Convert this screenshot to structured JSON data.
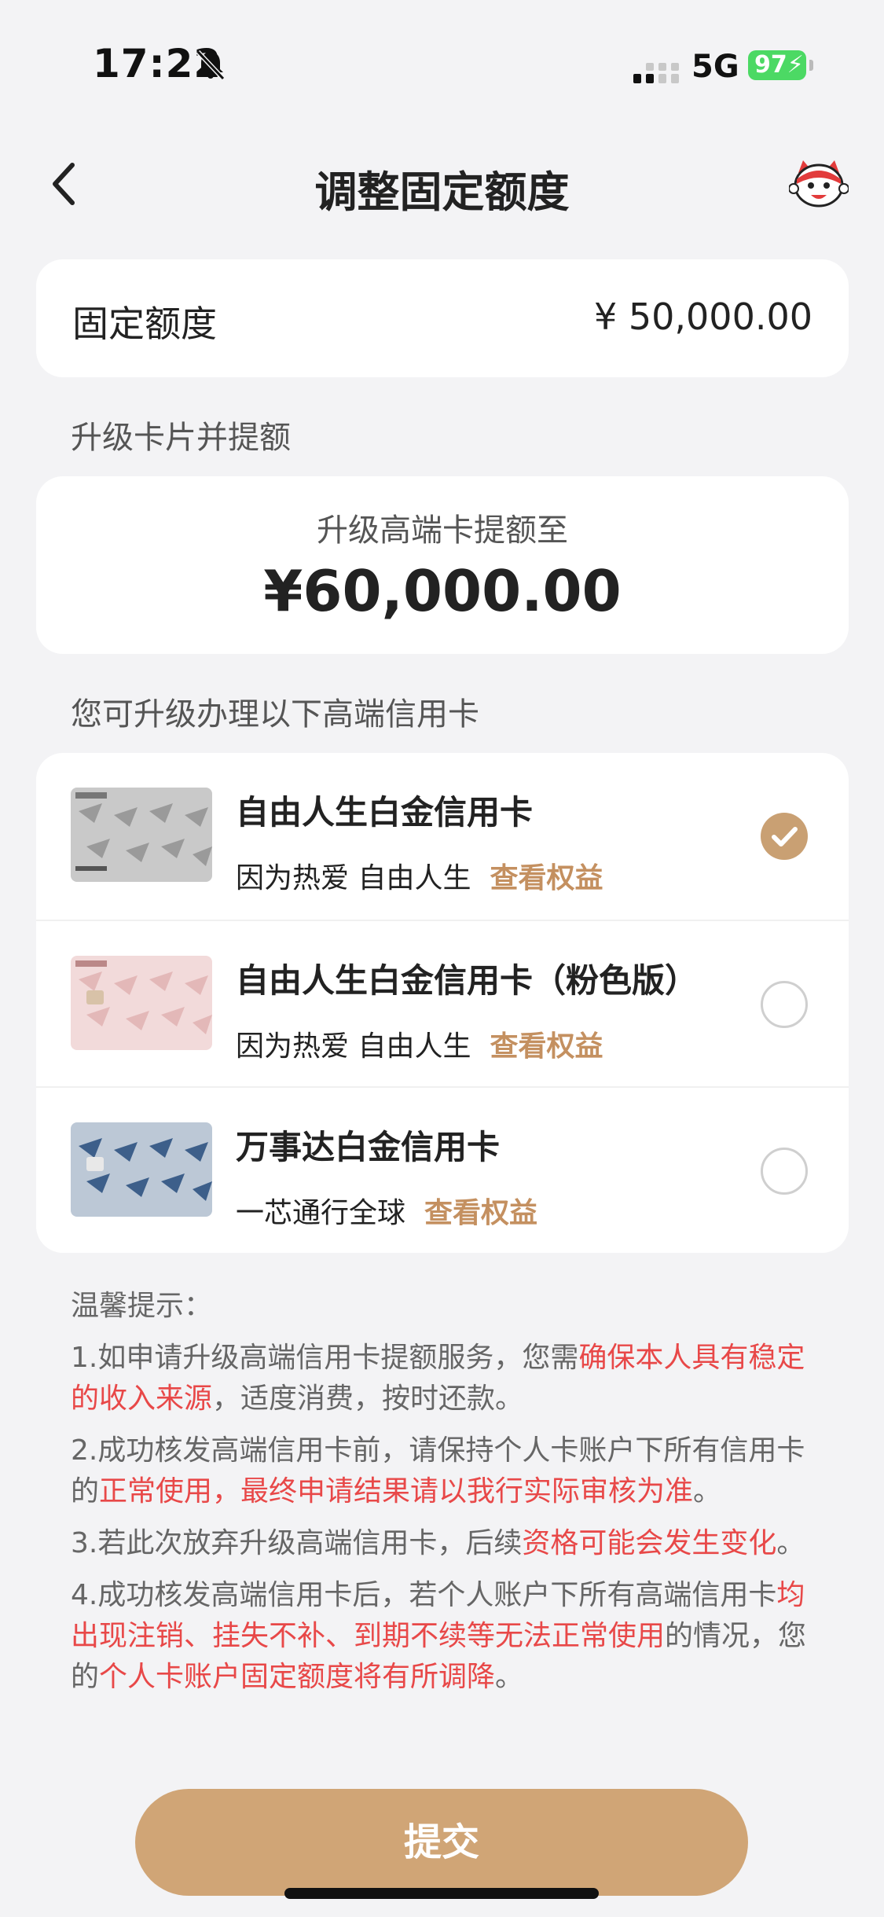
{
  "status_bar": {
    "time": "17:22",
    "network": "5G",
    "battery": "97"
  },
  "nav": {
    "title": "调整固定额度"
  },
  "fixed_limit": {
    "label": "固定额度",
    "value": "¥ 50,000.00"
  },
  "upgrade_section_label": "升级卡片并提额",
  "upgrade": {
    "caption": "升级高端卡提额至",
    "amount": "¥60,000.00"
  },
  "cards_section_label": "您可升级办理以下高端信用卡",
  "cards": [
    {
      "name": "自由人生白金信用卡",
      "desc": "因为热爱 自由人生",
      "link": "查看权益",
      "selected": true
    },
    {
      "name": "自由人生白金信用卡（粉色版）",
      "desc": "因为热爱 自由人生",
      "link": "查看权益",
      "selected": false
    },
    {
      "name": "万事达白金信用卡",
      "desc": "一芯通行全球",
      "link": "查看权益",
      "selected": false
    }
  ],
  "tips": {
    "title": "温馨提示：",
    "t1a": "1.如申请升级高端信用卡提额服务，您需",
    "t1b": "确保本人具有稳定的收入来源",
    "t1c": "，适度消费，按时还款。",
    "t2a": "2.成功核发高端信用卡前，请保持个人卡账户下所有信用卡的",
    "t2b": "正常使用，最终申请结果请以我行实际审核为准",
    "t2c": "。",
    "t3a": "3.若此次放弃升级高端信用卡，后续",
    "t3b": "资格可能会发生变化",
    "t3c": "。",
    "t4a": "4.成功核发高端信用卡后，若个人账户下所有高端信用卡",
    "t4b": "均出现注销、挂失不补、到期不续等无法正常使用",
    "t4c": "的情况，您的",
    "t4d": "个人卡账户固定额度将有所调降",
    "t4e": "。"
  },
  "submit_label": "提交",
  "colors": {
    "accent": "#d0a576",
    "link": "#c49060",
    "warning": "#e84848"
  }
}
